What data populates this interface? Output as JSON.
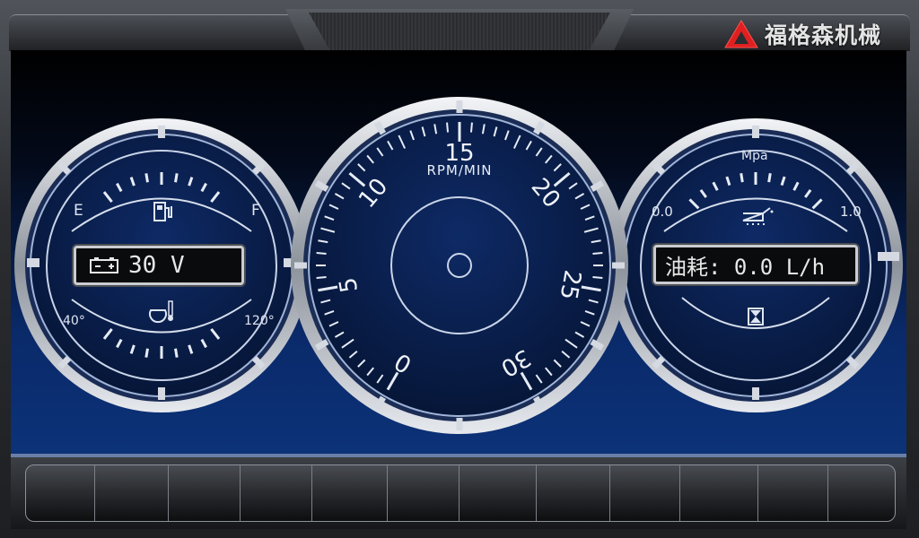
{
  "brand": {
    "name": "福格森机械",
    "logo": "red-triangle-logo"
  },
  "fuel_temp_gauge": {
    "fuel_empty_label": "E",
    "fuel_full_label": "F",
    "fuel_icon": "fuel-pump-icon",
    "battery_icon": "battery-icon",
    "voltage": "30 V",
    "coolant_icon": "coolant-temperature-icon",
    "temp_min_label": "40°",
    "temp_max_label": "120°"
  },
  "tachometer": {
    "unit_label": "RPM/MIN",
    "scale_labels": [
      "0",
      "5",
      "10",
      "15",
      "20",
      "25",
      "30"
    ],
    "center_hub": "needle-hub"
  },
  "oil_pressure_gauge": {
    "unit_label": "Mpa",
    "min_label": "0.0",
    "max_label": "1.0",
    "oil_icon": "oil-can-icon",
    "fuel_consumption": "油耗: 0.0 L/h",
    "hourglass_icon": "hourglass-icon"
  },
  "soft_buttons": [
    "",
    "",
    "",
    "",
    "",
    "",
    "",
    "",
    "",
    "",
    "",
    ""
  ],
  "colors": {
    "screen": "#0c3278",
    "bezel": "#c9ccd1",
    "brand_red": "#e02020"
  }
}
